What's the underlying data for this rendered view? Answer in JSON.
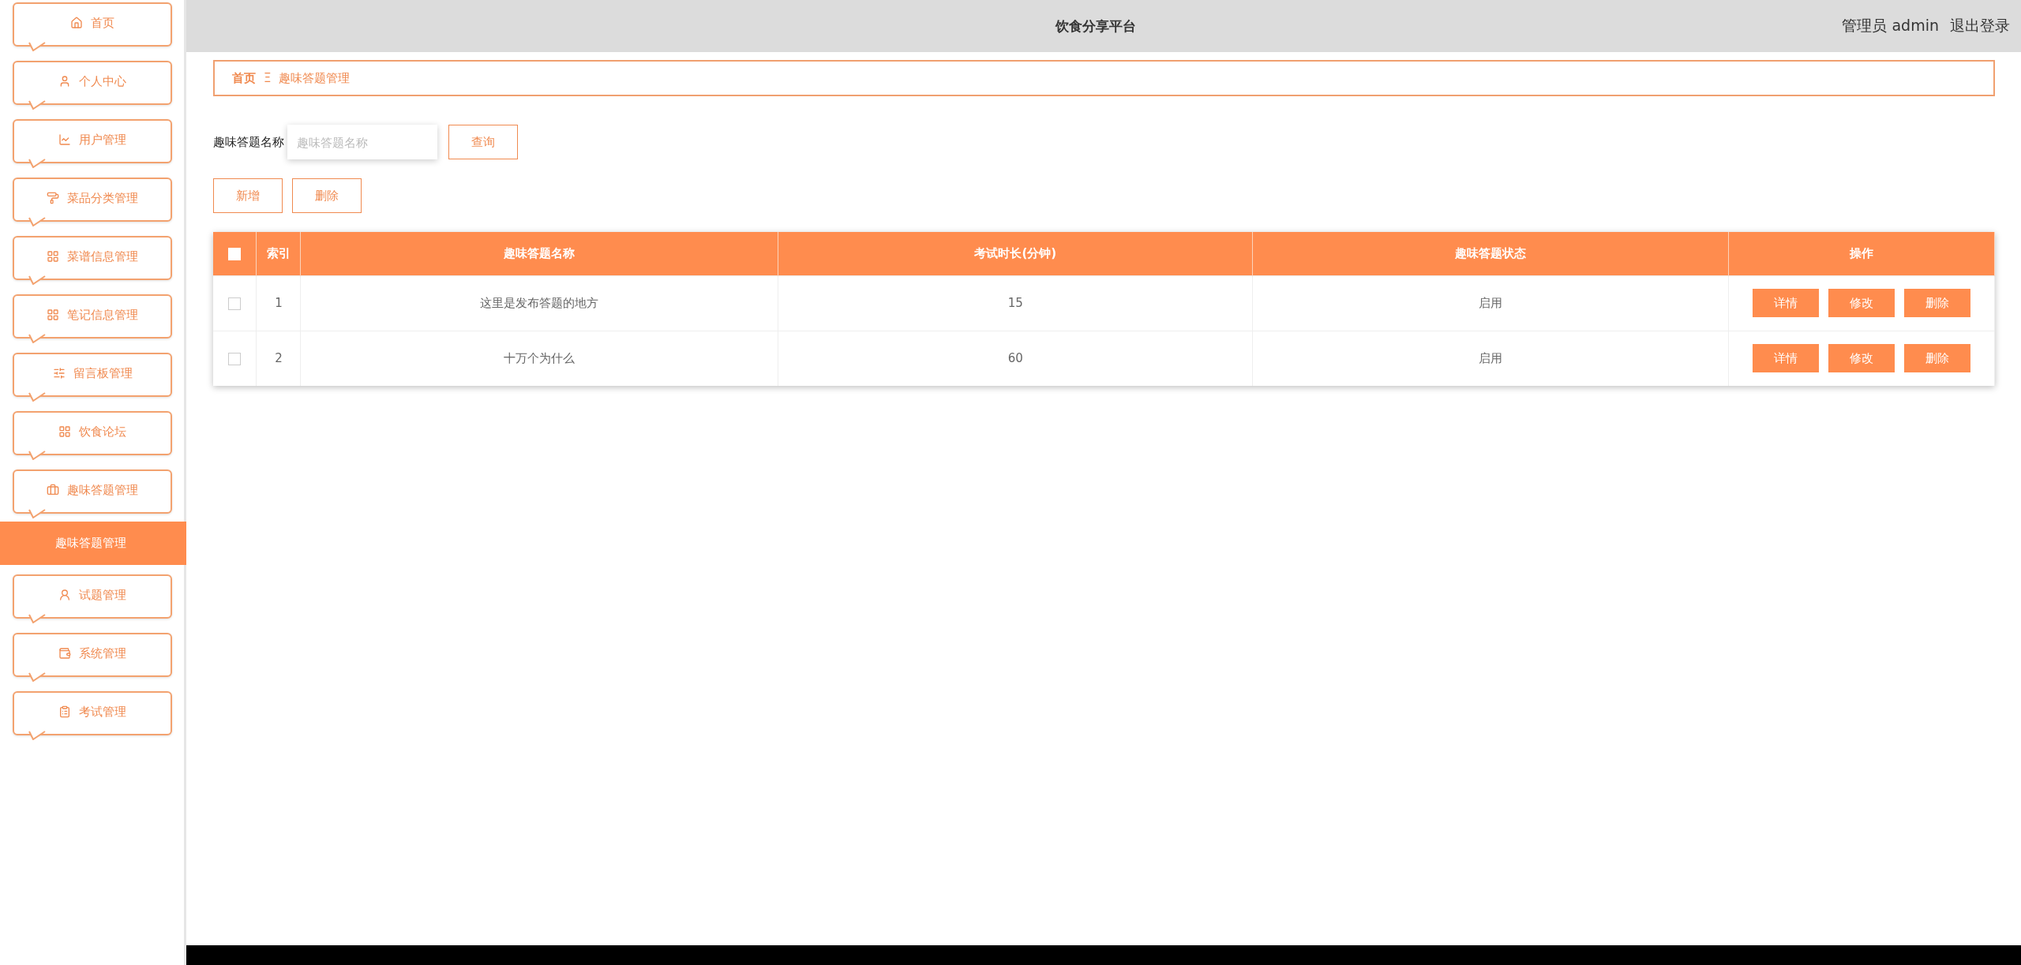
{
  "sidebar": {
    "items": [
      {
        "label": "首页",
        "selected": false
      },
      {
        "label": "个人中心",
        "selected": false
      },
      {
        "label": "用户管理",
        "selected": false
      },
      {
        "label": "菜品分类管理",
        "selected": false
      },
      {
        "label": "菜谱信息管理",
        "selected": false
      },
      {
        "label": "笔记信息管理",
        "selected": false
      },
      {
        "label": "留言板管理",
        "selected": false
      },
      {
        "label": "饮食论坛",
        "selected": false
      },
      {
        "label": "趣味答题管理",
        "selected": false,
        "children": [
          {
            "label": "趣味答题管理",
            "selected": true
          }
        ]
      },
      {
        "label": "试题管理",
        "selected": false
      },
      {
        "label": "系统管理",
        "selected": false
      },
      {
        "label": "考试管理",
        "selected": false
      }
    ]
  },
  "header": {
    "title": "饮食分享平台",
    "user": "管理员 admin",
    "logout": "退出登录"
  },
  "breadcrumb": [
    "首页",
    "趣味答题管理"
  ],
  "breadcrumb_separator": "Ξ",
  "search": {
    "label": "趣味答题名称",
    "placeholder": "趣味答题名称",
    "button": "查询"
  },
  "actions": [
    "新增",
    "删除"
  ],
  "table": {
    "select_all": {
      "checked": false
    },
    "columns": [
      "索引",
      "趣味答题名称",
      "考试时长(分钟)",
      "趣味答题状态",
      "操作"
    ],
    "rows": [
      {
        "checked": false,
        "cells": [
          "1",
          "这里是发布答题的地方",
          "15",
          "启用"
        ],
        "buttons": [
          "详情",
          "修改",
          "删除"
        ]
      },
      {
        "checked": false,
        "cells": [
          "2",
          "十万个为什么",
          "60",
          "启用"
        ],
        "buttons": [
          "详情",
          "修改",
          "删除"
        ]
      }
    ]
  }
}
